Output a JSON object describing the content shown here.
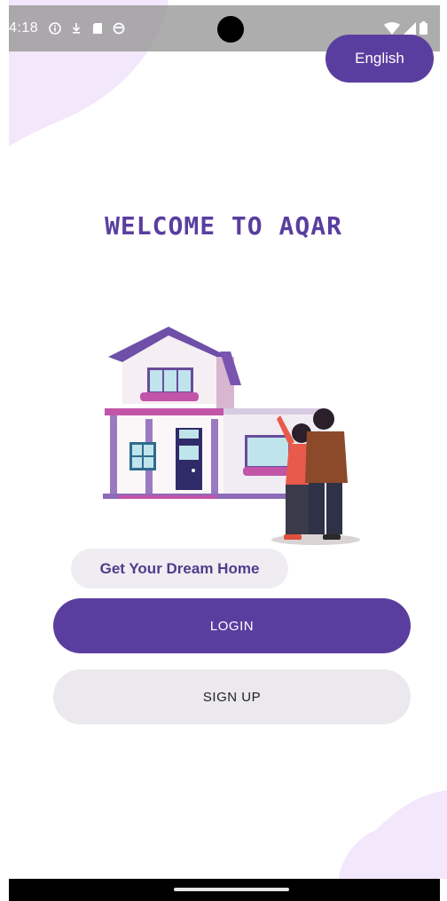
{
  "status_bar": {
    "time": "4:18",
    "left_icons": [
      "info-icon",
      "download-icon",
      "sd-card-icon",
      "vpn-icon"
    ],
    "right_icons": [
      "wifi-icon",
      "signal-icon",
      "battery-icon"
    ]
  },
  "language_button": {
    "label": "English"
  },
  "welcome": {
    "title": "WELCOME TO AQAR"
  },
  "illustration": {
    "icon": "house-couple-illustration"
  },
  "tagline": {
    "text": "Get Your Dream Home"
  },
  "actions": {
    "login_label": "LOGIN",
    "signup_label": "SIGN UP"
  },
  "theme": {
    "primary": "#5a3e9f",
    "chip_bg": "#efedf2",
    "secondary_bg": "#ebe9ed",
    "blob": "#f3e7fb"
  }
}
